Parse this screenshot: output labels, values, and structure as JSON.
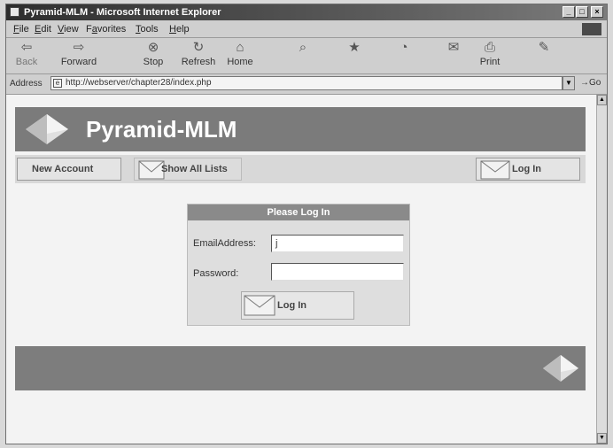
{
  "window": {
    "title": "Pyramid-MLM - Microsoft Internet Explorer",
    "controls": [
      "_",
      "□",
      "×"
    ]
  },
  "menu": {
    "items": [
      {
        "label": "File",
        "mnemonic": "F",
        "rest": "ile"
      },
      {
        "label": "Edit",
        "mnemonic": "E",
        "rest": "dit"
      },
      {
        "label": "View",
        "mnemonic": "V",
        "rest": "iew"
      },
      {
        "label": "Favorites",
        "mnemonic": "a",
        "pre": "F",
        "rest": "vorites"
      },
      {
        "label": "Tools",
        "mnemonic": "T",
        "rest": "ools"
      },
      {
        "label": "Help",
        "mnemonic": "H",
        "rest": "elp"
      }
    ]
  },
  "toolbar": {
    "back": "Back",
    "forward": "Forward",
    "stop": "Stop",
    "refresh": "Refresh",
    "home": "Home",
    "print": "Print",
    "icons": {
      "back": "⇦",
      "forward": "⇨",
      "stop": "⊗",
      "refresh": "↻",
      "home": "⌂",
      "search": "⌕",
      "favorites": "★",
      "history": "◔",
      "mail": "✉",
      "print": "⎙",
      "edit": "✎"
    }
  },
  "address": {
    "label": "Address",
    "url": "http://webserver/chapter28/index.php",
    "go": "Go",
    "dropdown_icon": "▼"
  },
  "page": {
    "site_title": "Pyramid-MLM",
    "nav": {
      "new_account": "New Account",
      "show_all_lists": "Show All Lists",
      "log_in": "Log In"
    },
    "login": {
      "heading": "Please Log In",
      "email_label": "EmailAddress:",
      "email_value": "j",
      "password_label": "Password:",
      "password_value": "",
      "button": "Log In"
    }
  },
  "scrollbar": {
    "up": "▲",
    "down": "▼"
  }
}
